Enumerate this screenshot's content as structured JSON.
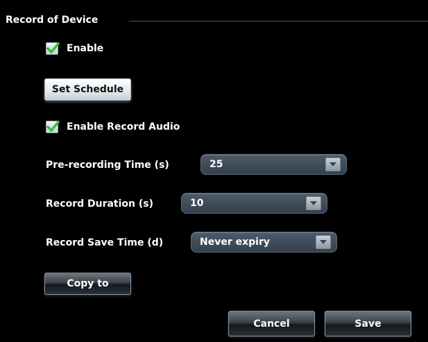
{
  "group": {
    "title": "Record of Device"
  },
  "enable": {
    "label": "Enable",
    "checked": true
  },
  "set_schedule_button": "Set Schedule",
  "enable_record_audio": {
    "label": "Enable Record Audio",
    "checked": true
  },
  "pre_recording_time": {
    "label": "Pre-recording Time (s)",
    "value": "25"
  },
  "record_duration": {
    "label": "Record Duration (s)",
    "value": "10"
  },
  "record_save_time": {
    "label": "Record Save Time (d)",
    "value": "Never expiry"
  },
  "copy_to_button": "Copy to",
  "cancel_button": "Cancel",
  "save_button": "Save",
  "colors": {
    "background": "#000000",
    "check_green": "#2ec43a",
    "select_bg": "#3d4b59",
    "text": "#ffffff"
  },
  "icons": {
    "checkbox": "checkmark-icon",
    "dropdown": "chevron-down-icon"
  }
}
